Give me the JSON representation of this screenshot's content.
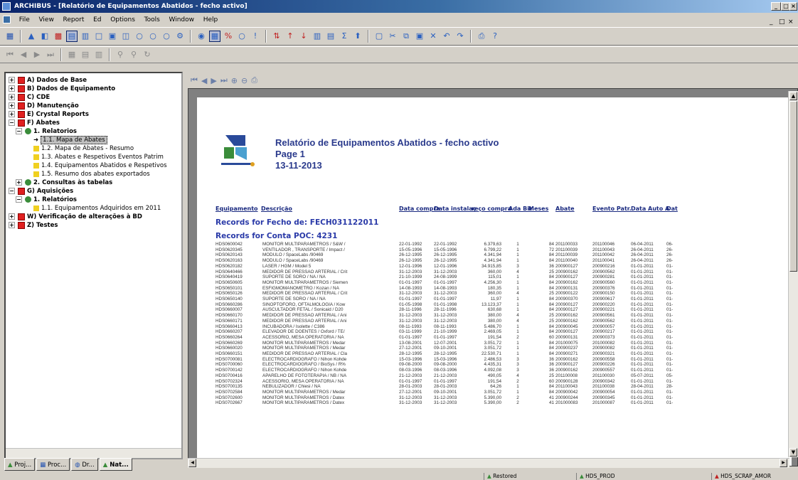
{
  "window": {
    "title": "ARCHIBUS - [Relatório de Equipamentos Abatidos - fecho activo]",
    "controls": [
      "_",
      "□",
      "×"
    ],
    "mdi_controls": [
      "_",
      "□",
      "×"
    ]
  },
  "menu": [
    "File",
    "View",
    "Report",
    "Ed",
    "Options",
    "Tools",
    "Window",
    "Help"
  ],
  "tree": [
    {
      "label": "A) Dados de Base",
      "level": 0,
      "bold": true,
      "icon": "red-square-icon",
      "expander": "+"
    },
    {
      "label": "B) Dados de Equipamento",
      "level": 0,
      "bold": true,
      "icon": "red-square-icon",
      "expander": "+"
    },
    {
      "label": "C) CDE",
      "level": 0,
      "bold": true,
      "icon": "red-square-icon",
      "expander": "+"
    },
    {
      "label": "D) Manutenção",
      "level": 0,
      "bold": true,
      "icon": "red-square-icon",
      "expander": "+"
    },
    {
      "label": "E) Crystal Reports",
      "level": 0,
      "bold": true,
      "icon": "red-square-icon",
      "expander": "+"
    },
    {
      "label": "F) Abates",
      "level": 0,
      "bold": true,
      "icon": "red-square-icon",
      "expander": "−"
    },
    {
      "label": "1. Relatorios",
      "level": 1,
      "bold": true,
      "icon": "gear-icon",
      "expander": "−"
    },
    {
      "label": "1.1. Mapa de Abates",
      "level": 2,
      "bold": false,
      "icon": "arrow-icon",
      "selected": true
    },
    {
      "label": "1.2. Mapa de Abates - Resumo",
      "level": 2,
      "bold": false,
      "icon": "report-icon"
    },
    {
      "label": "1.3. Abates e Respetivos Eventos Patrim",
      "level": 2,
      "bold": false,
      "icon": "report-icon"
    },
    {
      "label": "1.4. Equipamentos Abatidos e Respetivos",
      "level": 2,
      "bold": false,
      "icon": "report-icon"
    },
    {
      "label": "1.5. Resumo dos abates exportados",
      "level": 2,
      "bold": false,
      "icon": "report-icon"
    },
    {
      "label": "2. Consultas às tabelas",
      "level": 1,
      "bold": true,
      "icon": "gear-icon",
      "expander": "+"
    },
    {
      "label": "G) Aquisições",
      "level": 0,
      "bold": true,
      "icon": "red-square-icon",
      "expander": "−"
    },
    {
      "label": "1. Relatórios",
      "level": 1,
      "bold": true,
      "icon": "gear-icon",
      "expander": "−"
    },
    {
      "label": "1.1. Equipamentos Adquiridos em 2011",
      "level": 2,
      "bold": false,
      "icon": "report-icon"
    },
    {
      "label": "W) Verificação de alterações à BD",
      "level": 0,
      "bold": true,
      "icon": "red-square-icon",
      "expander": "+"
    },
    {
      "label": "Z) Testes",
      "level": 0,
      "bold": true,
      "icon": "red-square-icon",
      "expander": "+"
    }
  ],
  "tabs": [
    {
      "label": "Proj...",
      "active": false
    },
    {
      "label": "Proc...",
      "active": false
    },
    {
      "label": "Dr...",
      "active": false
    },
    {
      "label": "Nat...",
      "active": true
    }
  ],
  "report": {
    "title": "Relatório de Equipamentos Abatidos - fecho activo",
    "page": "Page 1",
    "date": "13-11-2013",
    "columns": [
      "Equipamento",
      "Descrição",
      "Data compra",
      "Data instalaç",
      "reço compra",
      "Ada Bit",
      "Meses",
      "Abate",
      "Evento Patr.",
      "Data Auto A",
      "Dat"
    ],
    "group1": "Records for Fecho de: FECH031122011",
    "group2": "Records for Conta POC: 4231",
    "rows": [
      [
        "HDS0600042",
        "MONITOR MULTIPARAMETROS / S&W /",
        "22-01-1992",
        "22-01-1992",
        "6.379,63",
        "1",
        "84",
        "201100033",
        "201100046",
        "06-04-2011",
        "06-"
      ],
      [
        "HDS0620345",
        "VENTILADOR , TRANSPORTE / Impact /",
        "15-05-1996",
        "15-05-1996",
        "6.799,22",
        "1",
        "72",
        "201100039",
        "201100043",
        "26-04-2011",
        "26-"
      ],
      [
        "HDS0620143",
        "MODULO / SpaceLabs /90469",
        "26-12-1995",
        "26-12-1995",
        "4.341,94",
        "1",
        "84",
        "201100039",
        "201100042",
        "26-04-2011",
        "26-"
      ],
      [
        "HDS0620163",
        "MODULO / SpaceLabs /90469",
        "26-12-1995",
        "26-12-1995",
        "4.341,94",
        "1",
        "84",
        "201100040",
        "201100041",
        "26-04-2011",
        "26-"
      ],
      [
        "HDS0620182",
        "LASER / HGM / Model 5",
        "12-01-1996",
        "12-01-1996",
        "34.915,85",
        "3",
        "36",
        "200900127",
        "200900216",
        "01-01-2011",
        "01-"
      ],
      [
        "HDS0640466",
        "MEDIDOR DE PRESSAO ARTERIAL / Crit",
        "31-12-2003",
        "31-12-2003",
        "360,00",
        "4",
        "25",
        "200900162",
        "200900562",
        "01-01-2011",
        "01-"
      ],
      [
        "HDS0640419",
        "SUPORTE DE SORO / NA / NA",
        "21-10-1999",
        "24-08-1999",
        "115,01",
        "1",
        "84",
        "200900127",
        "200900281",
        "01-01-2011",
        "01-"
      ],
      [
        "HDS0650605",
        "MONITOR MULTIPARAMETROS / Siemen",
        "01-01-1997",
        "01-01-1997",
        "4.256,30",
        "1",
        "84",
        "200900162",
        "200900560",
        "01-01-2011",
        "01-"
      ],
      [
        "HDS0650101",
        "ESFIGMOMANOMETRO / Kozan / NA",
        "14-08-1993",
        "14-08-1993",
        "180,35",
        "1",
        "84",
        "200900131",
        "200900376",
        "01-01-2011",
        "01-"
      ],
      [
        "HDS0650126",
        "MEDIDOR DE PRESSAO ARTERIAL / Crit",
        "31-12-2003",
        "31-12-2003",
        "360,00",
        "4",
        "25",
        "200900122",
        "200900150",
        "01-01-2011",
        "01-"
      ],
      [
        "HDS0650140",
        "SUPORTE DE SORO / NA / NA",
        "01-01-1997",
        "01-01-1997",
        "11,97",
        "1",
        "84",
        "200900370",
        "200900617",
        "01-01-2011",
        "01-"
      ],
      [
        "HDS0660286",
        "SINOPTOFORO, OFTALMOLOGIA / Kow",
        "01-05-1998",
        "01-01-1998",
        "13.123,37",
        "1",
        "84",
        "200900127",
        "200900220",
        "01-01-2011",
        "01-"
      ],
      [
        "HDS0660007",
        "AUSCULTADOR FETAL / Sonicaid / D20",
        "28-11-1996",
        "28-11-1996",
        "630,68",
        "1",
        "84",
        "200900127",
        "200900221",
        "01-01-2011",
        "01-"
      ],
      [
        "HDS0660170",
        "MEDIDOR DE PRESSAO ARTERIAL / Ani",
        "31-12-2003",
        "31-12-2003",
        "380,00",
        "4",
        "25",
        "200900162",
        "200900561",
        "01-01-2011",
        "01-"
      ],
      [
        "HDS0660171",
        "MEDIDOR DE PRESSAO ARTERIAL / Ani",
        "31-12-2003",
        "31-12-2003",
        "380,00",
        "4",
        "25",
        "200900162",
        "200900562",
        "01-01-2011",
        "01-"
      ],
      [
        "HDS0660413",
        "INCUBADORA / Isolette / C386",
        "08-11-1993",
        "08-11-1993",
        "5.486,70",
        "1",
        "84",
        "200900045",
        "200900057",
        "01-01-2011",
        "01-"
      ],
      [
        "HDS0660207",
        "ELEVADOR DE DOENTES / Oxford / TE/",
        "03-11-1999",
        "21-10-1999",
        "2.469,05",
        "1",
        "84",
        "200900127",
        "200900217",
        "01-01-2011",
        "01-"
      ],
      [
        "HDS0660264",
        "ACESSORIO, MESA OPERATORIA / NA",
        "01-01-1997",
        "01-01-1997",
        "191,54",
        "2",
        "60",
        "200900131",
        "200900373",
        "01-01-2011",
        "01-"
      ],
      [
        "HDS0660269",
        "MONITOR MULTIPARAMETROS / Medar",
        "13-08-2001",
        "12-07-2001",
        "3.051,72",
        "1",
        "84",
        "201000075",
        "201000082",
        "01-01-2011",
        "01-"
      ],
      [
        "HDS0660020",
        "MONITOR MULTIPARAMETROS / Medar",
        "27-12-2001",
        "09-10-2001",
        "3.051,72",
        "1",
        "84",
        "200900237",
        "200900082",
        "01-01-2011",
        "01-"
      ],
      [
        "HDS0660151",
        "MEDIDOR DE PRESSAO ARTERIAL / Cla",
        "28-12-1995",
        "28-12-1995",
        "22.530,71",
        "1",
        "84",
        "200900271",
        "200900321",
        "01-01-2011",
        "01-"
      ],
      [
        "HDS0700081",
        "ELECTROCARDIOGRAFO / Nihon Kohde",
        "15-03-1996",
        "15-03-1996",
        "2.486,53",
        "3",
        "36",
        "200900162",
        "200900558",
        "01-01-2011",
        "01-"
      ],
      [
        "HDS0700060",
        "ELECTROCARDIOGRAFO / BioSys / R%",
        "09-08-2000",
        "09-08-2000",
        "4.435,31",
        "3",
        "36",
        "200900127",
        "200900226",
        "01-01-2011",
        "01-"
      ],
      [
        "HDS0700142",
        "ELECTROCARDIOGRAFO / Nihon Kohde",
        "08-03-1996",
        "08-03-1996",
        "4.092,08",
        "3",
        "36",
        "200900162",
        "200900557",
        "01-01-2011",
        "01-"
      ],
      [
        "HDS0700416",
        "APARELHO DE FOTOTERAPIA / NB / NA",
        "21-12-2003",
        "21-12-2003",
        "490,05",
        "4",
        "25",
        "201100008",
        "201100030",
        "05-07-2011",
        "05-"
      ],
      [
        "HDS0702324",
        "ACESSORIO, MESA OPERATORIA / NA",
        "01-01-1997",
        "01-01-1997",
        "191,54",
        "2",
        "60",
        "200900128",
        "200900342",
        "01-01-2011",
        "01-"
      ],
      [
        "HDS0700135",
        "NEBULIZADOR / Chiesi / NA",
        "28-01-2003",
        "28-01-2003",
        "64,26",
        "1",
        "84",
        "201100043",
        "201100038",
        "28-04-2011",
        "28-"
      ],
      [
        "HDS0702584",
        "MONITOR MULTIPARAMETROS / Medar",
        "27-12-2001",
        "09-10-2001",
        "3.051,72",
        "1",
        "84",
        "200900042",
        "200900054",
        "01-01-2011",
        "01-"
      ],
      [
        "HDS0702600",
        "MONITOR MULTIPARAMETROS / Datex",
        "31-12-2003",
        "31-12-2003",
        "5.390,00",
        "2",
        "41",
        "200900244",
        "200900345",
        "01-01-2011",
        "01-"
      ],
      [
        "HDS0702667",
        "MONITOR MULTIPARAMETROS / Datex",
        "31-12-2003",
        "31-12-2003",
        "5.390,00",
        "2",
        "41",
        "201000083",
        "201000087",
        "01-01-2011",
        "01-"
      ]
    ]
  },
  "status": {
    "state": "Restored",
    "connection": "HDS_PROD",
    "user": "HDS_SCRAP_AMOR"
  }
}
